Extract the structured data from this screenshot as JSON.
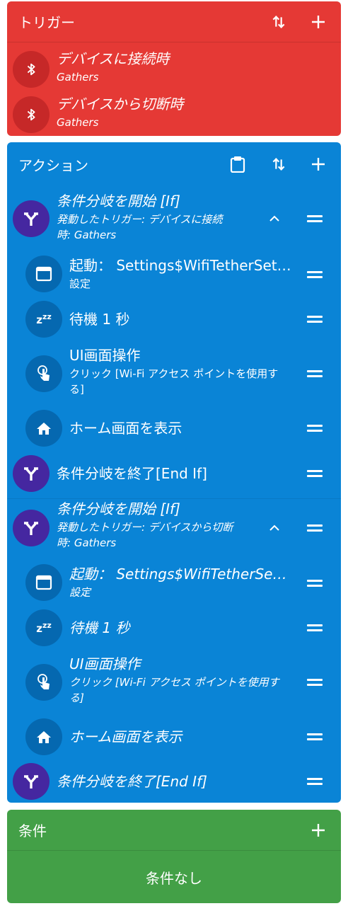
{
  "triggers": {
    "header": "トリガー",
    "items": [
      {
        "title": "デバイスに接続時",
        "sub": "Gathers",
        "icon": "bluetooth-icon"
      },
      {
        "title": "デバイスから切断時",
        "sub": "Gathers",
        "icon": "bluetooth-icon"
      }
    ]
  },
  "actions": {
    "header": "アクション",
    "items": [
      {
        "title": "条件分岐を開始 [If]",
        "sub": "発動したトリガー: デバイスに接続時: Gathers",
        "icon": "fork-icon"
      },
      {
        "title": "起動： Settings$WifiTetherSett…",
        "sub": "設定",
        "icon": "app-window-icon"
      },
      {
        "title": "待機 1 秒",
        "icon": "sleep-icon"
      },
      {
        "title": "UI画面操作",
        "sub": "クリック [Wi-Fi アクセス ポイントを使用する]",
        "icon": "touch-icon"
      },
      {
        "title": "ホーム画面を表示",
        "icon": "home-icon"
      },
      {
        "title": "条件分岐を終了[End If]",
        "icon": "fork-icon"
      },
      {
        "title": "条件分岐を開始 [If]",
        "sub": "発動したトリガー: デバイスから切断時: Gathers",
        "icon": "fork-icon"
      },
      {
        "title": "起動： Settings$WifiTetherSetti…",
        "sub": "設定",
        "icon": "app-window-icon"
      },
      {
        "title": "待機 1 秒",
        "icon": "sleep-icon"
      },
      {
        "title": "UI画面操作",
        "sub": "クリック [Wi-Fi アクセス ポイントを使用する]",
        "icon": "touch-icon"
      },
      {
        "title": "ホーム画面を表示",
        "icon": "home-icon"
      },
      {
        "title": "条件分岐を終了[End If]",
        "icon": "fork-icon"
      }
    ]
  },
  "conditions": {
    "header": "条件",
    "empty": "条件なし"
  },
  "colors": {
    "trigger": "#e53935",
    "action": "#0a84d6",
    "condition": "#43a047"
  }
}
